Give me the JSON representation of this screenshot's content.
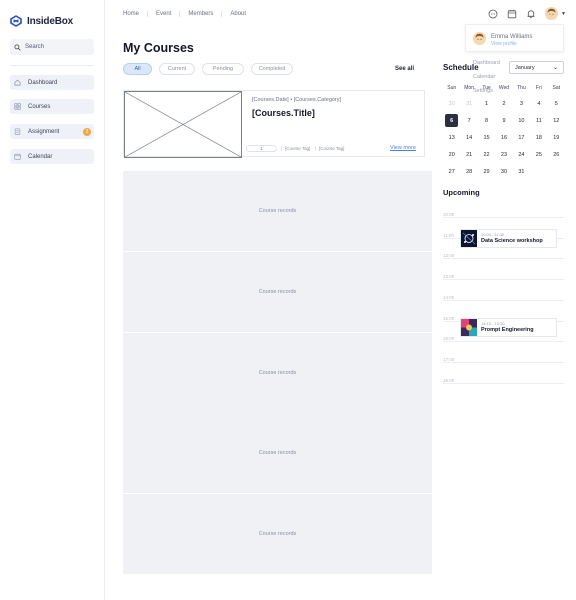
{
  "app": {
    "name": "InsideBox",
    "brand_color": "#2c4fb8"
  },
  "sidebar": {
    "search_label": "Search",
    "items": [
      {
        "label": "Dashboard",
        "icon": "home-icon"
      },
      {
        "label": "Courses",
        "icon": "grid-icon"
      },
      {
        "label": "Assignment",
        "icon": "clipboard-icon",
        "badge": "3"
      },
      {
        "label": "Calendar",
        "icon": "calendar-icon"
      }
    ]
  },
  "header": {
    "nav": [
      "Home",
      "Event",
      "Members",
      "About"
    ],
    "icons": [
      "chat-icon",
      "calendar-icon",
      "bell-icon"
    ]
  },
  "profile_menu": {
    "name": "Emma Williams",
    "link": "View profile",
    "ghost_items": [
      "Dashboard",
      "Calendar",
      "Settings"
    ]
  },
  "main": {
    "title": "My Courses",
    "filters": [
      "All",
      "Current",
      "Pending",
      "Completed"
    ],
    "active_filter": "All",
    "see_all": "See all",
    "featured": {
      "meta": "[Courses.Date] • [Courses.Category]",
      "title": "[Courses.Title]",
      "progress": "1",
      "tags": [
        "[Course Tag]",
        "[Course Tag]"
      ],
      "view_more": "View more"
    },
    "placeholder_label": "Course records",
    "placeholder_count": 5
  },
  "schedule": {
    "title": "Schedule",
    "month": "January",
    "weekdays": [
      "Sun",
      "Mon",
      "Tue",
      "Wed",
      "Thu",
      "Fri",
      "Sat"
    ],
    "days": [
      {
        "d": "30",
        "m": true
      },
      {
        "d": "31",
        "m": true
      },
      {
        "d": "1"
      },
      {
        "d": "2"
      },
      {
        "d": "3"
      },
      {
        "d": "4"
      },
      {
        "d": "5"
      },
      {
        "d": "6",
        "t": true
      },
      {
        "d": "7"
      },
      {
        "d": "8"
      },
      {
        "d": "9"
      },
      {
        "d": "10"
      },
      {
        "d": "11"
      },
      {
        "d": "12"
      },
      {
        "d": "13"
      },
      {
        "d": "14"
      },
      {
        "d": "15"
      },
      {
        "d": "16"
      },
      {
        "d": "17"
      },
      {
        "d": "18"
      },
      {
        "d": "19"
      },
      {
        "d": "20"
      },
      {
        "d": "21"
      },
      {
        "d": "22"
      },
      {
        "d": "23"
      },
      {
        "d": "24"
      },
      {
        "d": "25"
      },
      {
        "d": "26"
      },
      {
        "d": "27"
      },
      {
        "d": "28"
      },
      {
        "d": "29"
      },
      {
        "d": "30"
      },
      {
        "d": "31"
      }
    ],
    "upcoming_title": "Upcoming",
    "time_labels": [
      "10:00",
      "11:00",
      "12:00",
      "13:00",
      "14:00",
      "15:00",
      "16:00",
      "17:00",
      "18:00"
    ],
    "events": [
      {
        "time": "10:00 - 11:30",
        "title": "Data Science workshop"
      },
      {
        "time": "14:15 - 15:30",
        "title": "Prompt Engineering"
      }
    ]
  }
}
